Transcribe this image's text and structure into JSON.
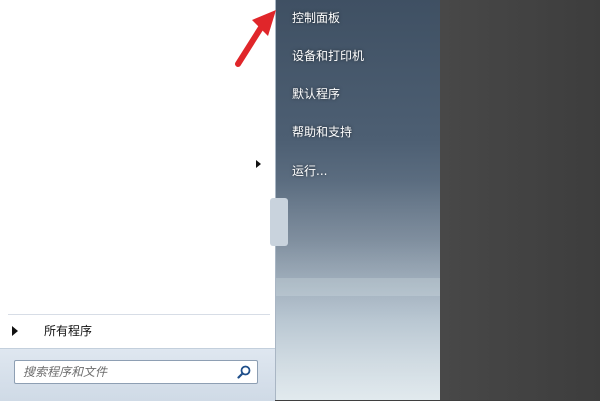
{
  "right_menu": {
    "items": [
      {
        "id": "control-panel",
        "label": "控制面板"
      },
      {
        "id": "devices-printers",
        "label": "设备和打印机"
      },
      {
        "id": "default-programs",
        "label": "默认程序"
      },
      {
        "id": "help-support",
        "label": "帮助和支持"
      },
      {
        "id": "run",
        "label": "运行..."
      }
    ]
  },
  "left_menu": {
    "all_programs_label": "所有程序"
  },
  "search": {
    "placeholder": "搜索程序和文件",
    "icon": "search-icon"
  },
  "colors": {
    "annotation_arrow": "#e0262a",
    "menu_text": "#ffffff"
  }
}
